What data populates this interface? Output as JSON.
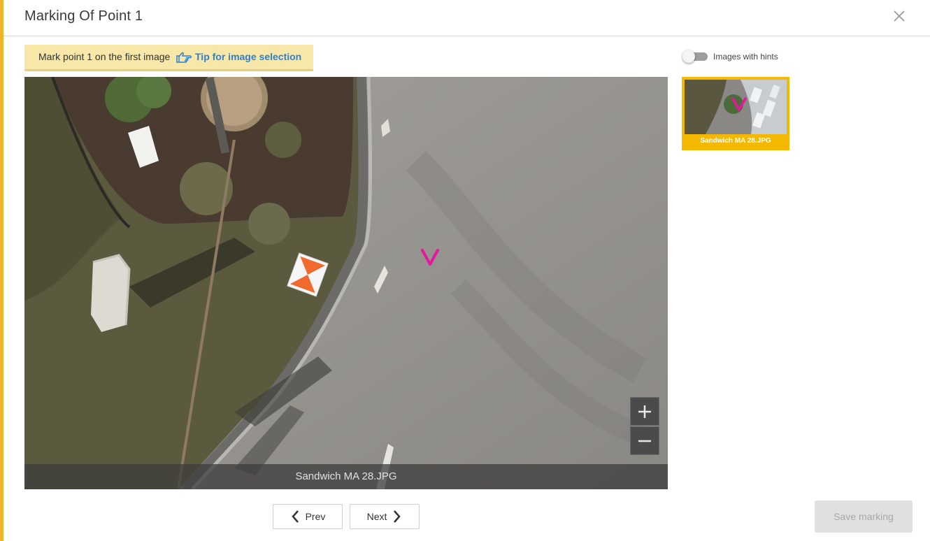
{
  "dialog": {
    "title": "Marking Of Point 1",
    "accent_color": "#f0b429"
  },
  "instruction": {
    "text": "Mark point 1 on the first image",
    "tip_label": "Tip for image selection",
    "tip_icon": "pointing-hand-icon"
  },
  "hints_toggle": {
    "label": "Images with hints",
    "enabled": false
  },
  "viewer": {
    "caption": "Sandwich MA 28.JPG",
    "marker_color": "#e6179c",
    "zoom_in_icon": "plus-icon",
    "zoom_out_icon": "minus-icon"
  },
  "thumbnails": [
    {
      "label": "Sandwich MA 28.JPG",
      "selected": true,
      "highlight_color": "#f5b800"
    }
  ],
  "navigation": {
    "prev_label": "Prev",
    "next_label": "Next"
  },
  "actions": {
    "save_label": "Save marking",
    "save_enabled": false
  }
}
